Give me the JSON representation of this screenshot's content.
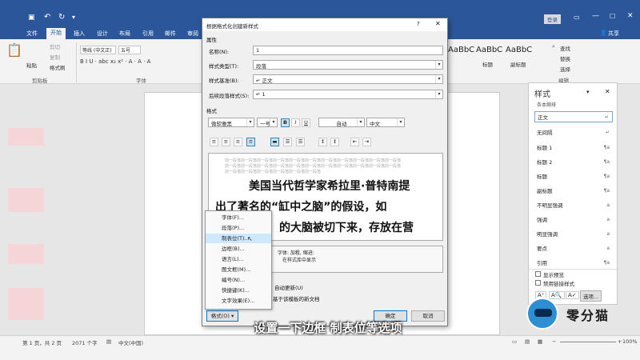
{
  "titlebar": {
    "login": "登录",
    "share": "共享",
    "quick_icons": [
      "save-icon",
      "undo-icon",
      "redo-icon",
      "customize-icon"
    ]
  },
  "ribbon_tabs": [
    "文件",
    "开始",
    "插入",
    "设计",
    "布局",
    "引用",
    "邮件",
    "审阅"
  ],
  "ribbon": {
    "clipboard": {
      "paste": "粘贴",
      "cut": "剪切",
      "copy": "复制",
      "format_painter": "格式刷",
      "label": "剪贴板"
    },
    "font": {
      "name": "等线 (中文正)",
      "size": "五号",
      "label": "字体"
    },
    "styles_gallery": [
      "AaBbC",
      "AaBbC",
      "AaBbC"
    ],
    "styles_gallery_labels": [
      "标题",
      "副标题"
    ],
    "editing": {
      "find": "查找",
      "replace": "替换",
      "select": "选择",
      "label": "编辑"
    }
  },
  "dialog": {
    "title": "根据格式化创建新样式",
    "help": "?",
    "section_props": "属性",
    "name_label": "名称(N):",
    "name_value": "1",
    "type_label": "样式类型(T):",
    "type_value": "段落",
    "based_label": "样式基准(B):",
    "based_value": "↵ 正文",
    "next_label": "后续段落样式(S):",
    "next_value": "↵ 1",
    "section_format": "格式",
    "font_value": "微软雅黑",
    "size_value": "一号",
    "bold": "B",
    "italic": "I",
    "underline": "U",
    "color_value": "自动",
    "lang_value": "中文",
    "preview_grey": [
      "前一段落前一段落前一段落前一段落前一段落前一段落前一段落前一段落前一段落前一段落前一段落",
      "前一段落前一段落前一段落前一段落前一段落前一段落前一段落前一段落前一段落前一段落前一段落",
      "前一段落前一段落前一段落前一段落前一段落前一段落"
    ],
    "preview_lines": [
      "美国当代哲学家希拉里·普特南提",
      "出了著名的“缸中之脑”的假设，如",
      "的大脑被切下来，存放在营"
    ],
    "desc_line1": "字体: 加粗, 缩进:",
    "desc_line2": "在样式库中显示",
    "auto_update": "自动更新(U)",
    "new_docs": "基于该模板的新文档",
    "format_btn": "格式(O) ▾",
    "ok": "确定",
    "cancel": "取消"
  },
  "context_menu": [
    "字体(F)...",
    "段落(P)...",
    "制表位(T)...",
    "边框(B)...",
    "语言(L)...",
    "图文框(M)...",
    "编号(N)...",
    "快捷键(K)...",
    "文字效果(E)..."
  ],
  "styles_pane": {
    "title": "样式",
    "top_item": "条本缩排",
    "items": [
      {
        "name": "正文",
        "mark": "↵"
      },
      {
        "name": "无间隔",
        "mark": "↵"
      },
      {
        "name": "标题 1",
        "mark": "¶a"
      },
      {
        "name": "标题 2",
        "mark": "¶a"
      },
      {
        "name": "标题",
        "mark": "¶a"
      },
      {
        "name": "副标题",
        "mark": "¶a"
      },
      {
        "name": "不明显强调",
        "mark": "a"
      },
      {
        "name": "强调",
        "mark": "a"
      },
      {
        "name": "明显强调",
        "mark": "a"
      },
      {
        "name": "要点",
        "mark": "a"
      },
      {
        "name": "引用",
        "mark": "¶a"
      }
    ],
    "show_preview": "显示预览",
    "disable_linked": "禁用链接样式",
    "options": "选项..."
  },
  "statusbar": {
    "page": "第 1 页，共 2 页",
    "words": "2071 个字",
    "lang": "中文(中国)",
    "zoom": "100%"
  },
  "subtitle": "设置一下边框 制表位等选项",
  "watermark": "零分猫",
  "colors": {
    "brand": "#2b579a",
    "highlight": "#cde8ff"
  }
}
